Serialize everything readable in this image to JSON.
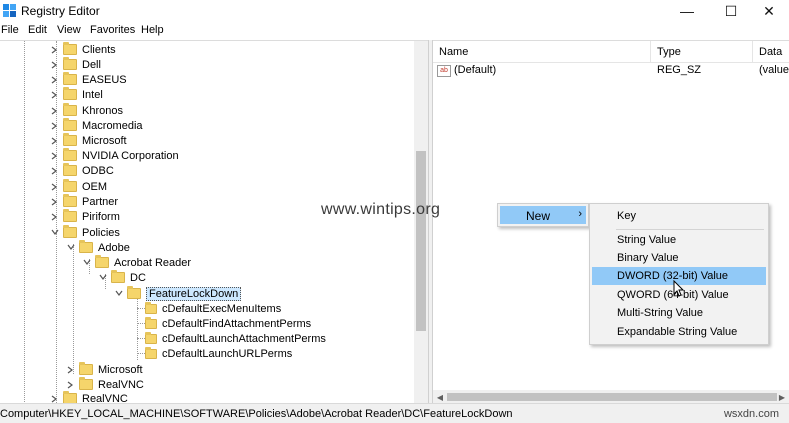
{
  "window": {
    "title": "Registry Editor",
    "icon": "registry-editor-icon"
  },
  "window_buttons": [
    "—",
    "☐",
    "✕"
  ],
  "menu": [
    "File",
    "Edit",
    "View",
    "Favorites",
    "Help"
  ],
  "tree": {
    "software_children": [
      "Clients",
      "Dell",
      "EASEUS",
      "Intel",
      "Khronos",
      "Macromedia",
      "Microsoft",
      "NVIDIA Corporation",
      "ODBC",
      "OEM",
      "Partner",
      "Piriform",
      "Policies"
    ],
    "policies_child": "Adobe",
    "adobe_child": "Acrobat Reader",
    "acrobat_child": "DC",
    "selected": "FeatureLockDown",
    "featurelockdown_children": [
      "cDefaultExecMenuItems",
      "cDefaultFindAttachmentPerms",
      "cDefaultLaunchAttachmentPerms",
      "cDefaultLaunchURLPerms"
    ],
    "policies_siblings_after": [
      "Microsoft",
      "RealVNC"
    ],
    "software_sibling_after": "RealVNC"
  },
  "list": {
    "columns": [
      "Name",
      "Type",
      "Data"
    ],
    "rows": [
      {
        "name": "(Default)",
        "type": "REG_SZ",
        "data": "(value"
      }
    ]
  },
  "context_menu": {
    "new_label": "New",
    "submenu": [
      "Key",
      "String Value",
      "Binary Value",
      "DWORD (32-bit) Value",
      "QWORD (64-bit) Value",
      "Multi-String Value",
      "Expandable String Value"
    ],
    "highlighted": "DWORD (32-bit) Value"
  },
  "watermark": "www.wintips.org",
  "status": {
    "path": "Computer\\HKEY_LOCAL_MACHINE\\SOFTWARE\\Policies\\Adobe\\Acrobat Reader\\DC\\FeatureLockDown",
    "site_mark": "wsxdn.com"
  },
  "colors": {
    "highlight": "#91c9f7",
    "selected_node": "#cde8ff",
    "folder": "#f5d56b"
  }
}
